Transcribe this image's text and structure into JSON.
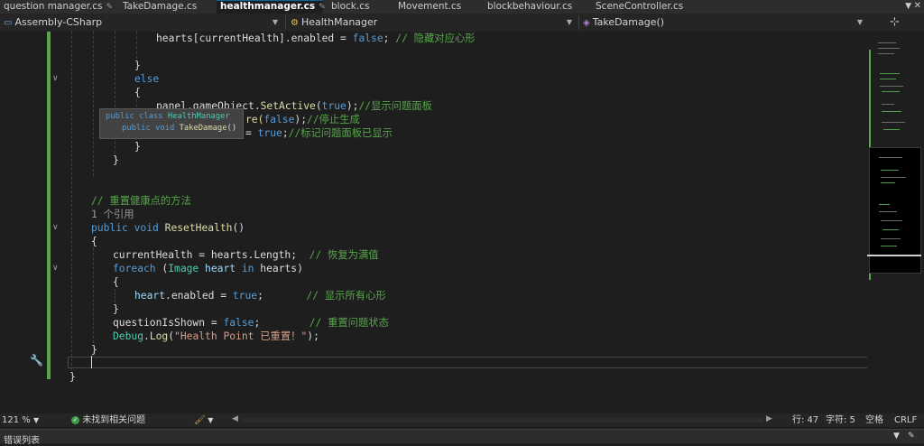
{
  "tabs": [
    {
      "label": "question manager.cs",
      "pinned": true,
      "active": false
    },
    {
      "label": "TakeDamage.cs",
      "pinned": false,
      "active": false
    },
    {
      "label": "healthmanager.cs",
      "pinned": true,
      "active": true
    },
    {
      "label": "block.cs",
      "pinned": false,
      "active": false
    },
    {
      "label": "Movement.cs",
      "pinned": false,
      "active": false
    },
    {
      "label": "blockbehaviour.cs",
      "pinned": false,
      "active": false
    },
    {
      "label": "SceneController.cs",
      "pinned": false,
      "active": false
    }
  ],
  "navbar": {
    "project": "Assembly-CSharp",
    "type": "HealthManager",
    "member": "TakeDamage()"
  },
  "code": {
    "l1_a": "hearts[currentHealth].enabled = ",
    "l1_kw": "false",
    "l1_b": "; ",
    "l1_cm": "// 隐藏对应心形",
    "l2": "}",
    "l3": "else",
    "l4": "{",
    "l5_a": "panel.gameObject.",
    "l5_fn": "SetActive",
    "l5_b": "(",
    "l5_kw": "true",
    "l5_c": ");",
    "l5_cm": "//显示问题面板",
    "l6_a": "re(",
    "l6_kw": "false",
    "l6_b": ");",
    "l6_cm": "//停止生成",
    "l7_a": "= ",
    "l7_kw": "true",
    "l7_b": ";",
    "l7_cm": "//标记问题面板已显示",
    "l8": "}",
    "l9": "}",
    "l10_cm": "// 重置健康点的方法",
    "l11_ref": "1 个引用",
    "l12_kw1": "public",
    "l12_kw2": "void",
    "l12_fn": "ResetHealth",
    "l12_b": "()",
    "l13": "{",
    "l14_a": "currentHealth = hearts.Length;",
    "l14_cm": "// 恢复为满值",
    "l15_kw": "foreach",
    "l15_a": " (",
    "l15_ty": "Image",
    "l15_fd": "heart",
    "l15_kw2": "in",
    "l15_b": " hearts)",
    "l16": "{",
    "l17_fd": "heart",
    "l17_a": ".enabled = ",
    "l17_kw": "true",
    "l17_b": ";",
    "l17_cm": "// 显示所有心形",
    "l18": "}",
    "l19_a": "questionIsShown = ",
    "l19_kw": "false",
    "l19_b": ";",
    "l19_cm": "// 重置问题状态",
    "l20_ty": "Debug",
    "l20_a": ".",
    "l20_fn": "Log",
    "l20_b": "(",
    "l20_st": "\"Health Point 已重置！\"",
    "l20_c": ");",
    "l21": "}",
    "l23": "}"
  },
  "tooltip": {
    "line1_kw": "public class",
    "line1_ty": "HealthManager",
    "line2_kw": "public void",
    "line2_fn": "TakeDamage",
    "line2_b": "()"
  },
  "status": {
    "zoom": "121 %",
    "issues": "未找到相关问题",
    "line": "行: 47",
    "col": "字符: 5",
    "indent": "空格",
    "eol": "CRLF"
  },
  "bottom_panel": {
    "title": "错误列表"
  },
  "colors": {
    "keyword": "#569cd6",
    "type": "#4ec9b0",
    "method": "#dcdcaa",
    "comment": "#57a64a",
    "string": "#d69d85",
    "change_bar": "#57a64a"
  }
}
